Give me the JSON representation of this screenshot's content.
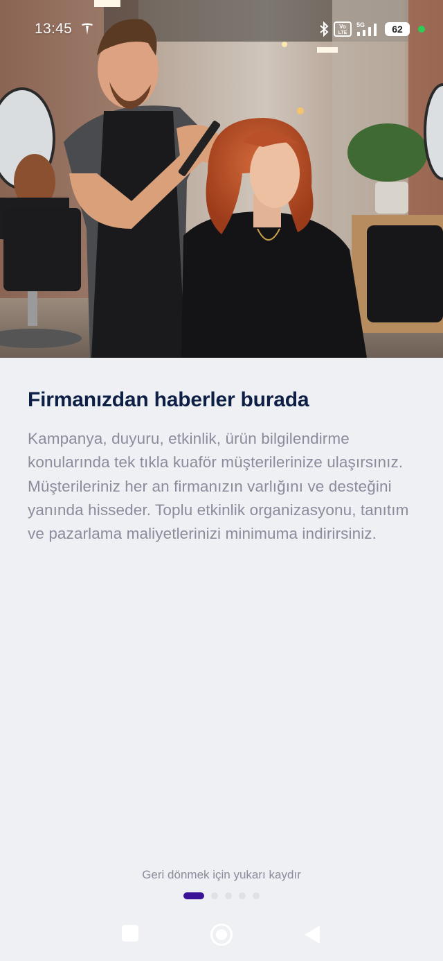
{
  "status_bar": {
    "time": "13:45",
    "left_icon": "tesla-logo-icon",
    "right_icons": [
      "bluetooth-icon",
      "volte-icon",
      "5g-signal-icon"
    ],
    "network_label": "5G",
    "volte_label": "Vo LTE",
    "battery_level": "62",
    "indicator_color": "#2ecc55"
  },
  "hero": {
    "image": "hairdresser-styling-client-photo"
  },
  "onboarding": {
    "title": "Firmanızdan haberler burada",
    "description": "Kampanya, duyuru, etkinlik, ürün bilgilendirme konularında tek tıkla kuaför müşterilerinize ulaşırsınız. Müşterileriniz her an firmanızın varlığını ve desteğini yanında hisseder. Toplu etkinlik organizasyonu, tanıtım ve pazarlama maliyetlerinizi minimuma indirirsiniz.",
    "swipe_hint": "Geri dönmek için yukarı kaydır",
    "page_count": 5,
    "active_page": 1,
    "accent_color": "#3a1396",
    "title_color": "#0e1f45"
  },
  "navigation": {
    "recent_icon": "square-recent-apps-icon",
    "home_icon": "circle-home-icon",
    "back_icon": "triangle-back-icon"
  }
}
